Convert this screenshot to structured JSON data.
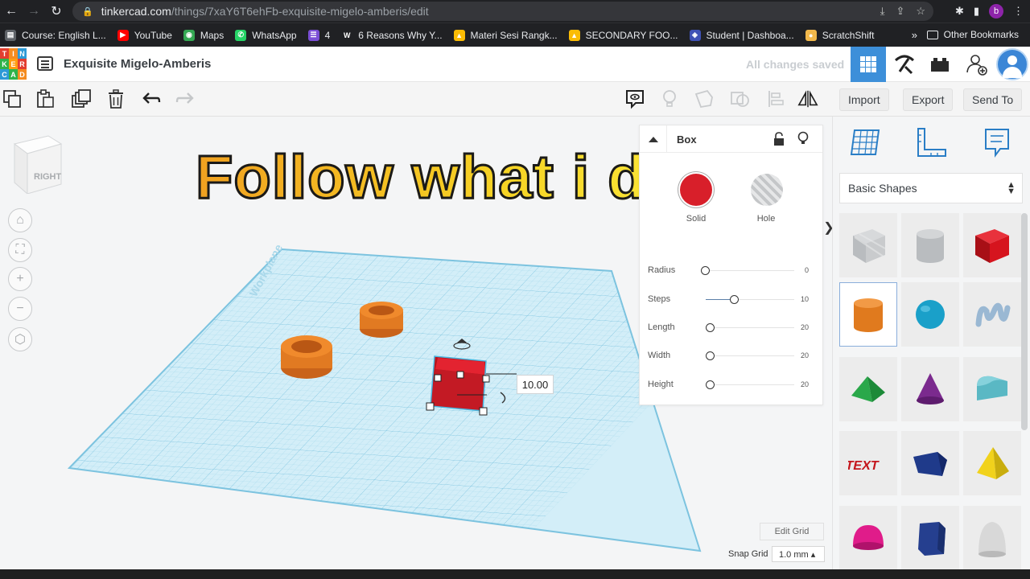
{
  "browser": {
    "url_domain": "tinkercad.com",
    "url_path": "/things/7xaY6T6ehFb-exquisite-migelo-amberis/edit",
    "profile_initial": "b"
  },
  "bookmarks": [
    {
      "label": "Course: English L...",
      "icon": "page-icon",
      "color": "#5f6368"
    },
    {
      "label": "YouTube",
      "icon": "youtube-icon",
      "color": "#ff0000"
    },
    {
      "label": "Maps",
      "icon": "maps-icon",
      "color": "#34a853"
    },
    {
      "label": "WhatsApp",
      "icon": "whatsapp-icon",
      "color": "#25d366"
    },
    {
      "label": "4",
      "icon": "list-icon",
      "color": "#7b4fd6"
    },
    {
      "label": "6 Reasons Why Y...",
      "icon": "w-icon",
      "color": "#202124"
    },
    {
      "label": "Materi Sesi Rangk...",
      "icon": "drive-icon",
      "color": "#fbbc04"
    },
    {
      "label": "SECONDARY FOO...",
      "icon": "drive-icon",
      "color": "#fbbc04"
    },
    {
      "label": "Student | Dashboa...",
      "icon": "shield-icon",
      "color": "#3f51b5"
    },
    {
      "label": "ScratchShift",
      "icon": "scratch-icon",
      "color": "#f2b84b"
    }
  ],
  "bookmarks_more": "»",
  "other_bookmarks": "Other Bookmarks",
  "header": {
    "title": "Exquisite Migelo-Amberis",
    "save_status": "All changes saved"
  },
  "toolbar": {
    "import": "Import",
    "export": "Export",
    "send_to": "Send To"
  },
  "viewcube": {
    "face": "RIGHT"
  },
  "overlay": {
    "text": "Follow what i do."
  },
  "workplane": {
    "label": "Workplane",
    "dimension_value": "10.00",
    "edit_grid": "Edit Grid",
    "snap_grid_label": "Snap Grid",
    "snap_grid_value": "1.0 mm ▴"
  },
  "inspector": {
    "title": "Box",
    "solid_label": "Solid",
    "hole_label": "Hole",
    "solid_color": "#d81f2a",
    "params": [
      {
        "label": "Radius",
        "value": "0",
        "position": 0.0
      },
      {
        "label": "Steps",
        "value": "10",
        "position": 0.33
      },
      {
        "label": "Length",
        "value": "20",
        "position": 0.05
      },
      {
        "label": "Width",
        "value": "20",
        "position": 0.05
      },
      {
        "label": "Height",
        "value": "20",
        "position": 0.05
      }
    ]
  },
  "shapes_panel": {
    "category": "Basic Shapes",
    "shapes": [
      {
        "name": "box-hole",
        "color": "#b9bcbf"
      },
      {
        "name": "cylinder-hole",
        "color": "#b9bcbf"
      },
      {
        "name": "box",
        "color": "#d6141e"
      },
      {
        "name": "cylinder",
        "color": "#e07a1e"
      },
      {
        "name": "sphere",
        "color": "#1aa0c9"
      },
      {
        "name": "scribble",
        "color": "#9ab8d3"
      },
      {
        "name": "roof",
        "color": "#2aa84a"
      },
      {
        "name": "cone",
        "color": "#7b2a8e"
      },
      {
        "name": "round-roof",
        "color": "#5ab8c4"
      },
      {
        "name": "text",
        "color": "#c4161c"
      },
      {
        "name": "wedge",
        "color": "#1f3a8a"
      },
      {
        "name": "pyramid",
        "color": "#f1d21c"
      },
      {
        "name": "half-sphere",
        "color": "#e01c8a"
      },
      {
        "name": "polygon",
        "color": "#253f8f"
      },
      {
        "name": "paraboloid",
        "color": "#d8d8d8"
      }
    ]
  },
  "colors": {
    "accent": "#3d8fd9",
    "grid": "#8fd0e8"
  }
}
